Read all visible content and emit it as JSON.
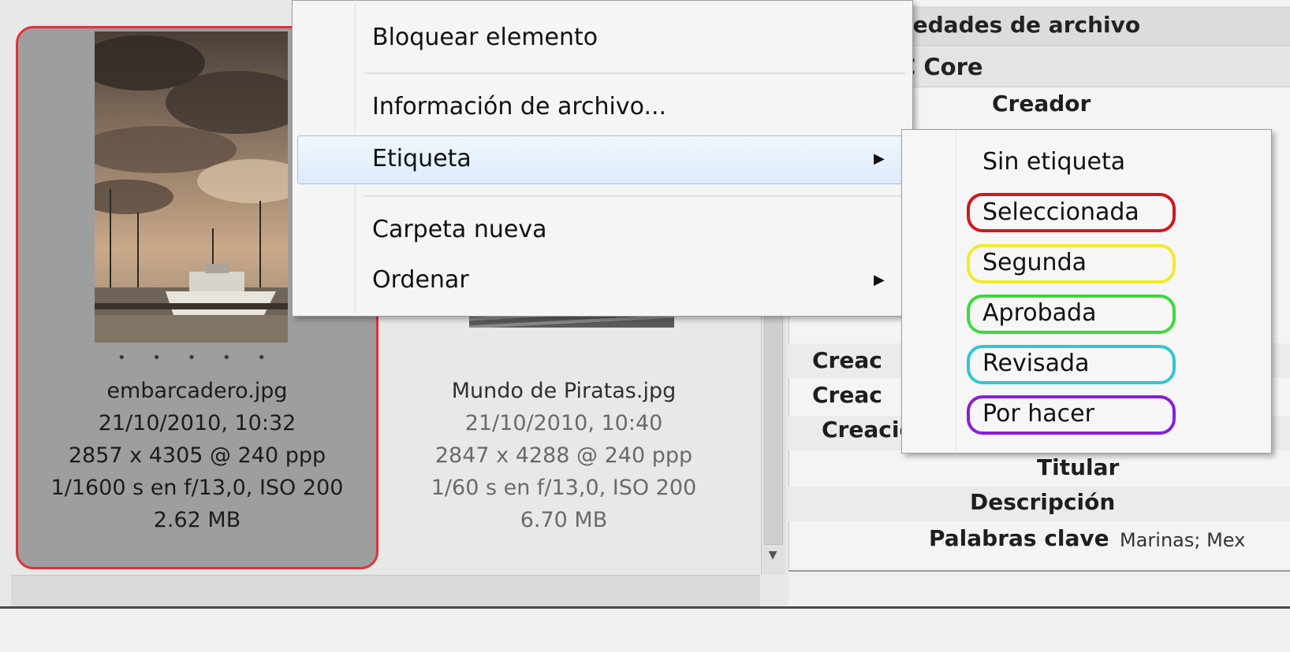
{
  "files": [
    {
      "name": "embarcadero.jpg",
      "date": "21/10/2010, 10:32",
      "dimensions": "2857 x 4305 @ 240 ppp",
      "exposure": "1/1600 s en f/13,0, ISO 200",
      "size": "2.62 MB",
      "rating": "• • • • •",
      "label_color": "#e0323a"
    },
    {
      "name": "Mundo de Piratas.jpg",
      "date": "21/10/2010, 10:40",
      "dimensions": "2847 x 4288 @ 240 ppp",
      "exposure": "1/60 s en f/13,0, ISO 200",
      "size": "6.70 MB"
    }
  ],
  "metadata_panel": {
    "section_title": "piedades de archivo",
    "subsection_title": "C Core",
    "fields": {
      "creator": "Creador",
      "creator_2": "Creac",
      "creator_3": "Creac",
      "creator_4": "Creacion Sitio(s) Web",
      "holder": "Titular",
      "description": "Descripción",
      "keywords": "Palabras clave",
      "keywords_value": "Marinas; Mex"
    }
  },
  "context_menu": {
    "items": [
      {
        "label": "Bloquear elemento"
      },
      {
        "label": "Información de archivo..."
      },
      {
        "label": "Etiqueta",
        "has_submenu": true,
        "highlighted": true
      },
      {
        "label": "Carpeta nueva"
      },
      {
        "label": "Ordenar",
        "has_submenu": true
      }
    ],
    "arrow_glyph": "▶"
  },
  "label_submenu": {
    "options": [
      {
        "label": "Sin etiqueta",
        "color": ""
      },
      {
        "label": "Seleccionada",
        "color": "#d4161c"
      },
      {
        "label": "Segunda",
        "color": "#f2ea2a"
      },
      {
        "label": "Aprobada",
        "color": "#3cd93c"
      },
      {
        "label": "Revisada",
        "color": "#2fc8d2"
      },
      {
        "label": "Por hacer",
        "color": "#8a1ed6"
      }
    ]
  },
  "scrollbar": {
    "down_arrow_glyph": "▼"
  }
}
